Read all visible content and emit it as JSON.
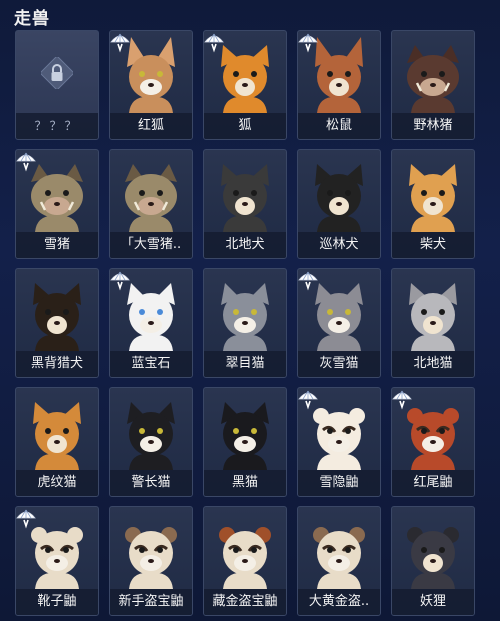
{
  "header": {
    "title": "走兽"
  },
  "colors": {
    "card_bg": "#243049",
    "label_bg": "#141c30",
    "badge": "#ffffff"
  },
  "cards": [
    {
      "label": "？？？",
      "locked": true,
      "new": false,
      "icon": "lock-icon"
    },
    {
      "label": "红狐",
      "new": true,
      "icon": "caracal",
      "fur": "#c98f5c",
      "ear": "#d9a06f"
    },
    {
      "label": "狐",
      "new": true,
      "icon": "fox",
      "fur": "#e08a2c",
      "ear": "#e08a2c"
    },
    {
      "label": "松鼠",
      "new": true,
      "icon": "squirrel",
      "fur": "#b4643a",
      "ear": "#b4643a"
    },
    {
      "label": "野林猪",
      "new": false,
      "icon": "boar",
      "fur": "#5a3a30",
      "ear": "#4a2e26"
    },
    {
      "label": "雪猪",
      "new": true,
      "icon": "snow-boar",
      "fur": "#9a8a6a",
      "ear": "#6a5a44"
    },
    {
      "label": "「大雪猪..",
      "new": false,
      "icon": "big-snow-boar",
      "fur": "#9a8a6a",
      "ear": "#6a5a44"
    },
    {
      "label": "北地犬",
      "new": false,
      "icon": "husky",
      "fur": "#3a3a3a",
      "ear": "#3a3a3a"
    },
    {
      "label": "巡林犬",
      "new": false,
      "icon": "border-collie",
      "fur": "#222222",
      "ear": "#222222"
    },
    {
      "label": "柴犬",
      "new": false,
      "icon": "shiba",
      "fur": "#e0a050",
      "ear": "#e0a050"
    },
    {
      "label": "黑背猎犬",
      "new": false,
      "icon": "german-shepherd",
      "fur": "#2a2018",
      "ear": "#2a2018"
    },
    {
      "label": "蓝宝石",
      "new": true,
      "icon": "white-cat-blue-eyes",
      "fur": "#f2f2f2",
      "ear": "#f2f2f2"
    },
    {
      "label": "翠目猫",
      "new": false,
      "icon": "grey-cat",
      "fur": "#8a8f9a",
      "ear": "#8a8f9a"
    },
    {
      "label": "灰雪猫",
      "new": true,
      "icon": "grey-white-cat",
      "fur": "#8c8c94",
      "ear": "#8c8c94"
    },
    {
      "label": "北地猫",
      "new": false,
      "icon": "silver-tabby",
      "fur": "#b8b8bc",
      "ear": "#9a9aa0"
    },
    {
      "label": "虎纹猫",
      "new": false,
      "icon": "orange-tabby",
      "fur": "#d48a3a",
      "ear": "#d48a3a"
    },
    {
      "label": "警长猫",
      "new": false,
      "icon": "tuxedo-cat",
      "fur": "#1e1e22",
      "ear": "#1e1e22"
    },
    {
      "label": "黑猫",
      "new": false,
      "icon": "black-cat",
      "fur": "#1a1a1e",
      "ear": "#1a1a1e"
    },
    {
      "label": "雪隐鼬",
      "new": true,
      "icon": "white-ferret",
      "fur": "#f4ece0",
      "ear": "#f4ece0"
    },
    {
      "label": "红尾鼬",
      "new": true,
      "icon": "red-ferret",
      "fur": "#b84a2a",
      "ear": "#b84a2a"
    },
    {
      "label": "靴子鼬",
      "new": true,
      "icon": "boot-ferret",
      "fur": "#e8dcc8",
      "ear": "#e8dcc8"
    },
    {
      "label": "新手盗宝鼬",
      "new": false,
      "icon": "thief-ferret",
      "fur": "#e8dcc8",
      "ear": "#8a6a50"
    },
    {
      "label": "藏金盗宝鼬",
      "new": false,
      "icon": "gold-thief-ferret",
      "fur": "#e8dcc8",
      "ear": "#a0502a"
    },
    {
      "label": "大黄金盗..",
      "new": false,
      "icon": "big-gold-thief-ferret",
      "fur": "#e8dcc8",
      "ear": "#8a6a50"
    },
    {
      "label": "妖狸",
      "new": false,
      "icon": "tanuki",
      "fur": "#3a3a44",
      "ear": "#2a2a30"
    }
  ]
}
